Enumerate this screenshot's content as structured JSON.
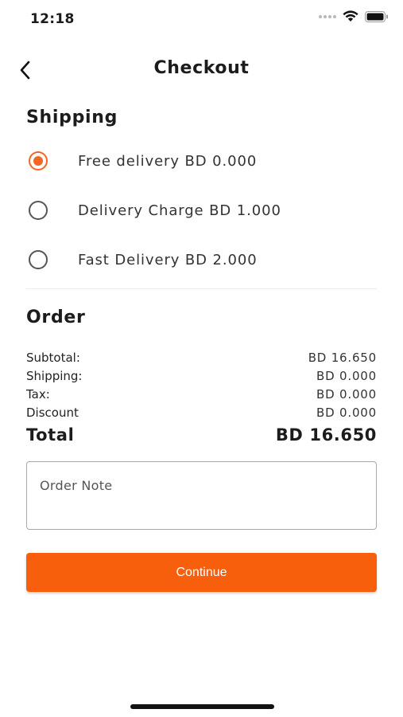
{
  "status_bar": {
    "time": "12:18"
  },
  "header": {
    "title": "Checkout"
  },
  "shipping": {
    "title": "Shipping",
    "options": [
      {
        "label": "Free delivery BD 0.000",
        "selected": true
      },
      {
        "label": "Delivery Charge BD 1.000",
        "selected": false
      },
      {
        "label": "Fast Delivery BD 2.000",
        "selected": false
      }
    ]
  },
  "order": {
    "title": "Order",
    "rows": [
      {
        "label": "Subtotal:",
        "value": "BD 16.650"
      },
      {
        "label": "Shipping:",
        "value": "BD 0.000"
      },
      {
        "label": "Tax:",
        "value": "BD 0.000"
      },
      {
        "label": "Discount",
        "value": "BD 0.000"
      }
    ],
    "total_label": "Total",
    "total_value": "BD 16.650"
  },
  "note": {
    "placeholder": "Order Note"
  },
  "continue_label": "Continue",
  "colors": {
    "accent": "#f75f0c",
    "radio_selected": "#f26522"
  }
}
